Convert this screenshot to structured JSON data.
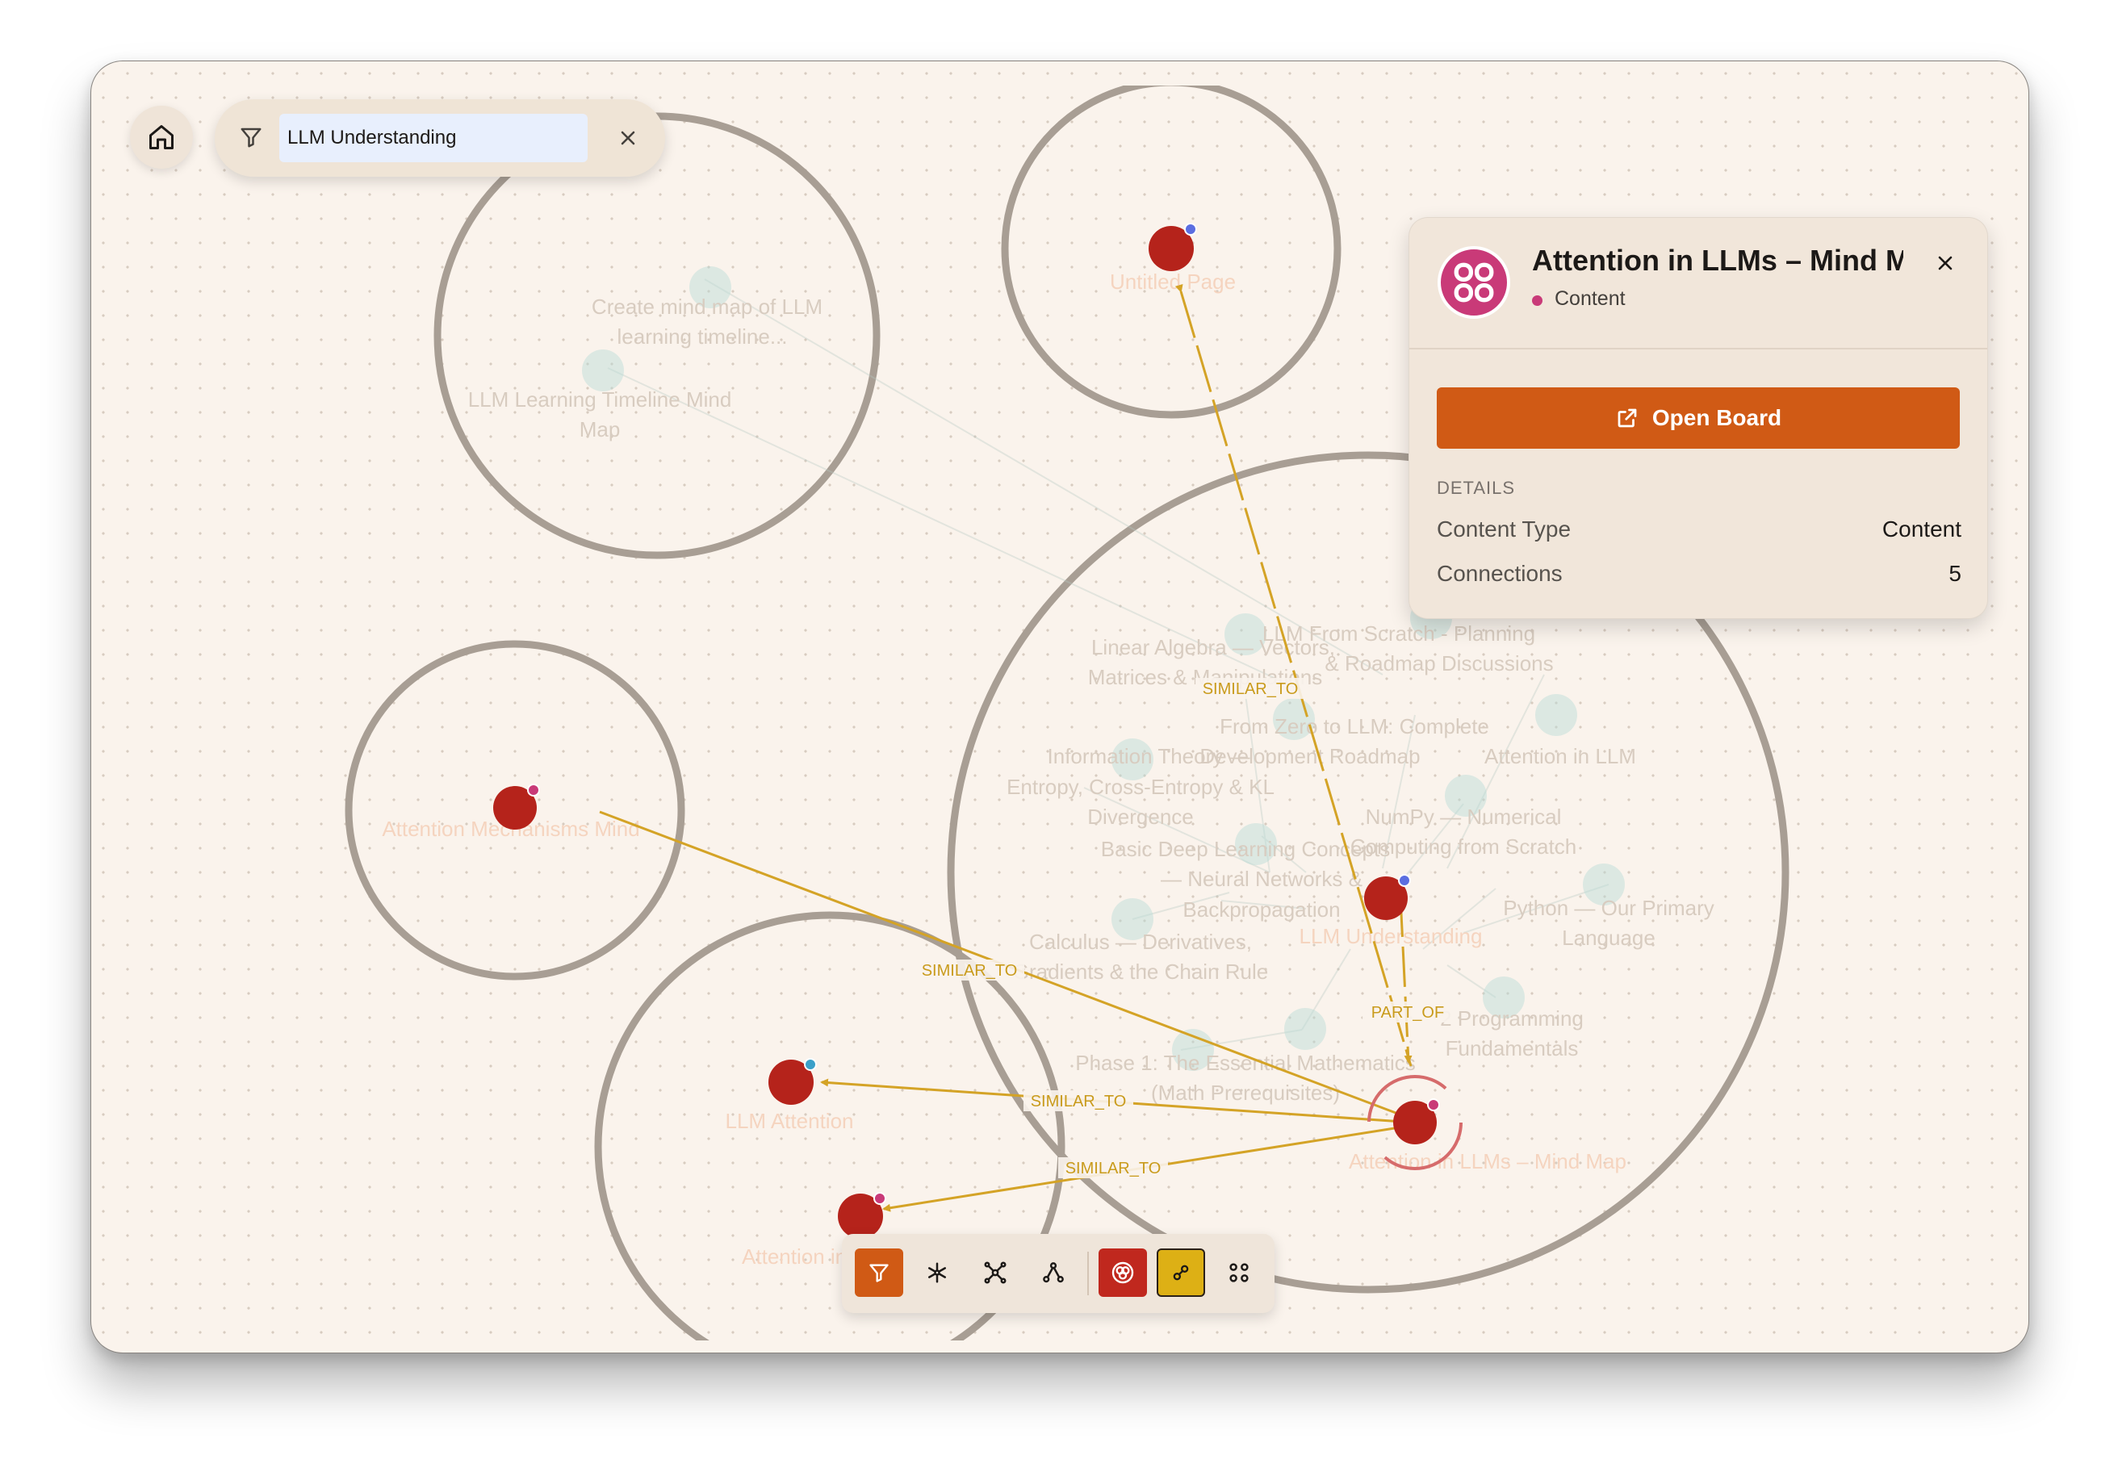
{
  "filter": {
    "value": "LLM Understanding",
    "filter_icon": "filter-icon",
    "clear_icon": "close-icon"
  },
  "home_icon": "home-icon",
  "colors": {
    "canvas": "#faf3ec",
    "node": "#b5231b",
    "edge": "#d4a326",
    "cluster": "#a89e94",
    "accent": "#d05a15",
    "content_type": "#c93a78"
  },
  "graph": {
    "faded_labels": [
      "Create mind map of LLM",
      "learning timeline...",
      "LLM Learning Timeline Mind",
      "Map",
      "Untitled Page",
      "Attention Mechanisms Mind",
      "LLM From Scratch - Planning",
      "& Roadmap Discussions",
      "Linear Algebra — Vectors,",
      "Matrices & Manipulations",
      "From Zero to LLM: Complete",
      "Attention in LLM",
      "Information Theory —",
      "Development Roadmap",
      "Entropy, Cross-Entropy & KL",
      "Divergence",
      "NumPy — Numerical",
      "Basic Deep Learning Concepts",
      "Computing from Scratch",
      "— Neural Networks &",
      "Backpropagation",
      "LLM Understanding",
      "Python — Our Primary",
      "Language",
      "Calculus — Derivatives,",
      "Gradients & the Chain Rule",
      "2 Programming",
      "Fundamentals",
      "Phase 1: The Essential Mathematics",
      "(Math Prerequisites)",
      "LLM Attention",
      "Attention in LLMs – Mind Map",
      "Attention in LLM"
    ],
    "edge_labels": [
      "SIMILAR_TO",
      "SIMILAR_TO",
      "PART_OF",
      "SIMILAR_TO",
      "SIMILAR_TO"
    ]
  },
  "panel": {
    "title": "Attention in LLMs – Mind Map",
    "type": "Content",
    "icon": "board-grid-icon",
    "close_icon": "close-icon",
    "open_button": "Open Board",
    "open_icon": "external-link-icon",
    "details_heading": "DETAILS",
    "rows": [
      {
        "label": "Content Type",
        "value": "Content"
      },
      {
        "label": "Connections",
        "value": "5"
      }
    ]
  },
  "toolbar": {
    "buttons": [
      {
        "icon": "filter-funnel-icon",
        "state": "active"
      },
      {
        "icon": "asterisk-layout-icon",
        "state": "normal"
      },
      {
        "icon": "network-cross-icon",
        "state": "normal"
      },
      {
        "icon": "tree-layout-icon",
        "state": "normal"
      },
      {
        "icon": "cluster-rings-icon",
        "state": "active"
      },
      {
        "icon": "link-nodes-icon",
        "state": "active"
      },
      {
        "icon": "grid-dots-icon",
        "state": "normal"
      }
    ]
  }
}
